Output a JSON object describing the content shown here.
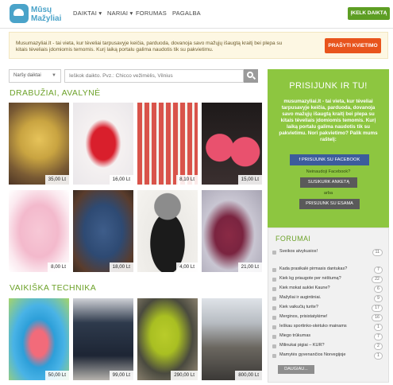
{
  "header": {
    "logo_line1": "Mūsų",
    "logo_line2": "Mažyliai",
    "nav": [
      "DAIKTAI",
      "NARIAI",
      "FORUMAS",
      "PAGALBA"
    ],
    "upload_button": "ĮKELK DAIKTĄ"
  },
  "promo": {
    "text": "Musumazyliai.lt - tai vieta, kur tėveliai tarpusavyje keičia, parduoda, dovanoja savo mažųjų išaugtą kraitį bei plepa su kitais tėveliais įdomiomis temomis. Kurį laiką portalu galima naudotis tik su pakvietimu.",
    "button": "PRAŠYTI KVIETIMO"
  },
  "search": {
    "category": "Naršy daiktai",
    "placeholder": "Ieškok daikto. Pvz.: Chicco vežimėlis, Vilnius"
  },
  "sections": {
    "clothes": {
      "title": "DRABUŽIAI, AVALYNĖ",
      "prices": [
        "35,00 Lt",
        "16,00 Lt",
        "8,10 Lt",
        "15,00 Lt",
        "8,00 Lt",
        "18,00 Lt",
        "4,00 Lt",
        "21,00 Lt"
      ]
    },
    "tech": {
      "title": "VAIKIŠKA TECHNIKA",
      "prices": [
        "50,00 Lt",
        "99,00 Lt",
        "290,00 Lt",
        "800,00 Lt"
      ]
    }
  },
  "signup": {
    "title": "PRISIJUNK IR TU!",
    "text": "musumazyliai.lt - tai vieta, kur tėveliai tarpusavyje keičia, parduoda, dovanoja savo mažųjų išaugtą kraitį bei plepa su kitais tėveliais įdomiomis temomis. Kurį laiką portalu galima naudotis tik su pakvietimu. Nori pakvietimo? Palik mums raštelį:",
    "facebook_button": "PRISIJUNK SU FACEBOOK",
    "no_facebook": "Neinaudoji Facebook?",
    "create_button": "SUSIKURK ANKETĄ",
    "or": "arba",
    "login_button": "PRISIJUNK SU ESAMA"
  },
  "forum": {
    "title": "FORUMAI",
    "items": [
      {
        "label": "Sveikos atvykusios!",
        "count": "11"
      },
      {
        "label": "Kada prasikalė pirmasis dantukas?",
        "count": "7"
      },
      {
        "label": "Kiek kg priaugote per nėštumą?",
        "count": "22"
      },
      {
        "label": "Kiek mokat auklei Kaune?",
        "count": "6"
      },
      {
        "label": "Mažyliai ir augintiniai.",
        "count": "9"
      },
      {
        "label": "Kiek vaikučių turite?",
        "count": "17"
      },
      {
        "label": "Merginos, prisistatykime!",
        "count": "16"
      },
      {
        "label": "Ieškau sportinko-skėtuko mainams",
        "count": "1"
      },
      {
        "label": "Miego trūkumas",
        "count": "7"
      },
      {
        "label": "Milinukai pigiai – KUR?",
        "count": "2"
      },
      {
        "label": "Mamytės gyvenančios Norvegijoje",
        "count": "1"
      }
    ],
    "more_button": "DAUGIAU..."
  },
  "colors": {
    "brand_green": "#8dc640",
    "accent_orange": "#e8541c",
    "facebook_blue": "#3c5c9c"
  }
}
